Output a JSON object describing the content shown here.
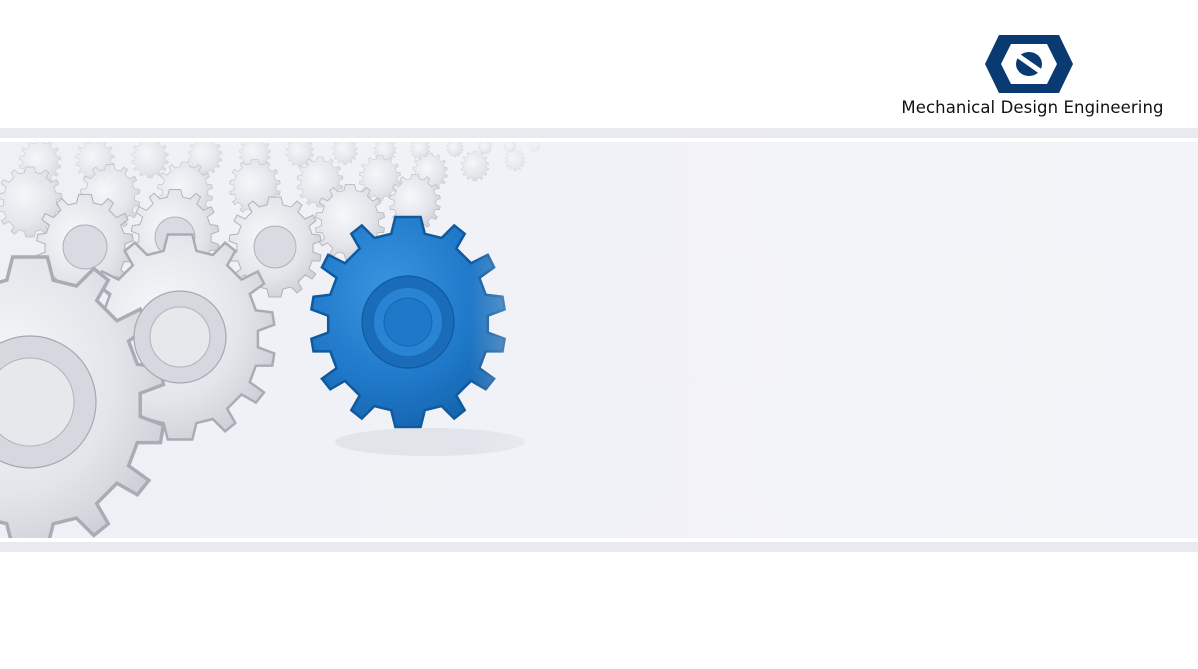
{
  "header": {
    "brand_name": "Mechanical Design Engineering",
    "logo_icon": "hex-nut-logo-icon",
    "brand_color": "#0a3a72"
  },
  "banner": {
    "image_icon": "gears-row-illustration",
    "highlight_gear_color": "#1f78c8",
    "background_color": "#f1f2f7"
  },
  "bands": {
    "color": "#e9eaef"
  }
}
